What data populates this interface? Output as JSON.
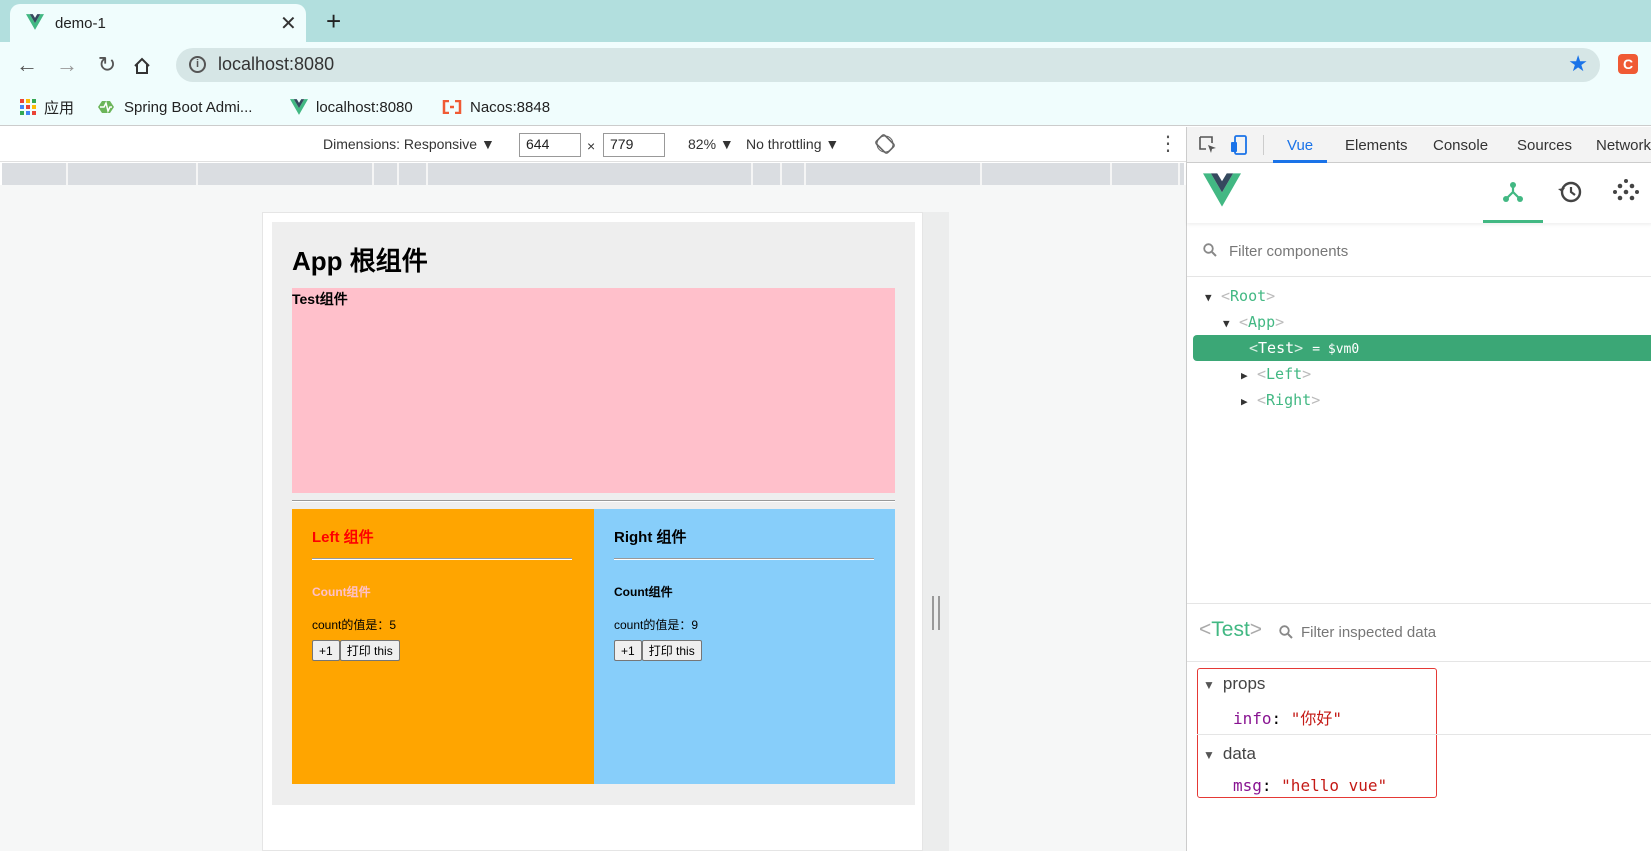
{
  "browser": {
    "tab_title": "demo-1",
    "url": "localhost:8080",
    "bookmarks": [
      {
        "label": "应用",
        "icon": "apps-grid-icon"
      },
      {
        "label": "Spring Boot Admi...",
        "icon": "spring-boot-icon"
      },
      {
        "label": "localhost:8080",
        "icon": "vue-icon"
      },
      {
        "label": "Nacos:8848",
        "icon": "nacos-icon"
      }
    ],
    "colors": {
      "tabstrip": "#b2dfde",
      "toolbar": "#f0fdfd",
      "extension": "#f05a34"
    }
  },
  "device_toolbar": {
    "dimensions_label": "Dimensions: Responsive ▼",
    "width": "644",
    "times": "×",
    "height": "779",
    "zoom": "82% ▼",
    "throttling": "No throttling ▼"
  },
  "page": {
    "app_title": "App 根组件",
    "test_label": "Test组件",
    "left": {
      "title": "Left 组件",
      "count_title": "Count组件",
      "count_value": "count的值是：5",
      "btn_inc": "+1",
      "btn_print": "打印 this",
      "bg": "#ffa500",
      "title_color": "#ff0000",
      "count_title_color": "#ffc0cb"
    },
    "right": {
      "title": "Right 组件",
      "count_title": "Count组件",
      "count_value": "count的值是：9",
      "btn_inc": "+1",
      "btn_print": "打印 this",
      "bg": "#87cefa"
    },
    "colors": {
      "app_bg": "#eeeeee",
      "test_bg": "#ffc0cb"
    }
  },
  "devtools": {
    "tabs": [
      "Vue",
      "Elements",
      "Console",
      "Sources",
      "Network"
    ],
    "active_tab": "Vue",
    "filter_placeholder": "Filter components",
    "tree": [
      {
        "name": "Root",
        "level": 0,
        "expanded": true
      },
      {
        "name": "App",
        "level": 1,
        "expanded": true
      },
      {
        "name": "Test",
        "level": 2,
        "selected": true,
        "suffix": "= $vm0"
      },
      {
        "name": "Left",
        "level": 2,
        "expanded": false
      },
      {
        "name": "Right",
        "level": 2,
        "expanded": false
      }
    ],
    "inspector": {
      "component": "Test",
      "filter_placeholder": "Filter inspected data",
      "props_label": "props",
      "props_key": "info",
      "props_value": "\"你好\"",
      "data_label": "data",
      "data_key": "msg",
      "data_value": "\"hello vue\""
    },
    "accent": "#42b883",
    "selected_bg": "#3ba776"
  }
}
